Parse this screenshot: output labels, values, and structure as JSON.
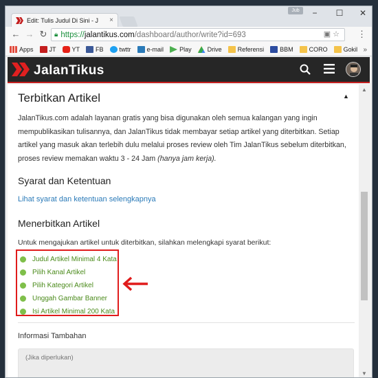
{
  "browser": {
    "tab_title": "Edit: Tulis Judul Di Sini - J",
    "tab_close": "×",
    "user_badge": "Jub",
    "window_controls": [
      "−",
      "☐",
      "✕"
    ],
    "url_https": "https://",
    "url_host": "jalantikus.com",
    "url_path": "/dashboard/author/write?id=693",
    "bookmarks": [
      {
        "label": "Apps",
        "icon": "apps-icon",
        "color": "#e04a3c"
      },
      {
        "label": "JT",
        "icon": "jalantikus-icon",
        "color": "#c41e1e"
      },
      {
        "label": "YT",
        "icon": "youtube-icon",
        "color": "#e62117"
      },
      {
        "label": "FB",
        "icon": "facebook-icon",
        "color": "#3b5998"
      },
      {
        "label": "twttr",
        "icon": "twitter-icon",
        "color": "#1da1f2"
      },
      {
        "label": "e-mail",
        "icon": "zoho-mail-icon",
        "color": "#2a7ab8"
      },
      {
        "label": "Play",
        "icon": "play-store-icon",
        "color": "#4caf50"
      },
      {
        "label": "Drive",
        "icon": "drive-icon",
        "color": "#fbbc05"
      },
      {
        "label": "Referensi",
        "icon": "folder-icon",
        "color": "#f4c34a"
      },
      {
        "label": "BBM",
        "icon": "bbm-icon",
        "color": "#2c4ca0"
      },
      {
        "label": "CORO",
        "icon": "folder-icon",
        "color": "#f4c34a"
      },
      {
        "label": "Gokil",
        "icon": "folder-icon",
        "color": "#f4c34a"
      }
    ]
  },
  "site": {
    "logo_text": "JalanTikus",
    "brand_color": "#c41e1e"
  },
  "page": {
    "title": "Terbitkan Artikel",
    "description_plain": "JalanTikus.com adalah layanan gratis yang bisa digunakan oleh semua kalangan yang ingin mempublikasikan tulisannya, dan JalanTikus tidak membayar setiap artikel yang diterbitkan. Setiap artikel yang masuk akan terlebih dulu melalui proses review oleh Tim JalanTikus sebelum diterbitkan, proses review memakan waktu 3 - 24 Jam ",
    "description_em": "(hanya jam kerja).",
    "terms_heading": "Syarat dan Ketentuan",
    "terms_link": "Lihat syarat dan ketentuan selengkapnya",
    "publish_heading": "Menerbitkan Artikel",
    "publish_intro": "Untuk mengajukan artikel untuk diterbitkan, silahkan melengkapi syarat berikut:",
    "requirements": [
      "Judul Artikel Minimal 4 Kata",
      "Pilih Kanal Artikel",
      "Pilih Kategori Artikel",
      "Unggah Gambar Banner",
      "Isi Artikel Minimal 200 Kata"
    ],
    "additional_label": "Informasi Tambahan",
    "additional_placeholder": "(Jika diperlukan)"
  }
}
